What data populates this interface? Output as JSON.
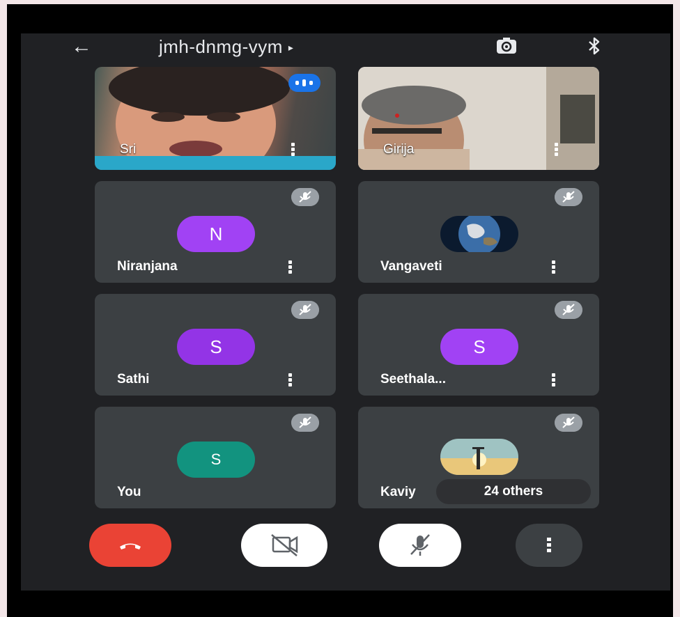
{
  "meeting": {
    "code": "jmh-dnmg-vym",
    "caret": "▸",
    "back_icon": "←"
  },
  "participants": [
    {
      "name": "Sri",
      "type": "video"
    },
    {
      "name": "Girija",
      "type": "video"
    },
    {
      "name": "Niranjana",
      "initial": "N",
      "avatar_color": "#a142f4"
    },
    {
      "name": "Vangaveti",
      "avatar": "earth-photo"
    },
    {
      "name": "Sathi",
      "initial": "S",
      "avatar_color": "#9334e6"
    },
    {
      "name": "Seethala...",
      "initial": "S",
      "avatar_color": "#a142f4"
    },
    {
      "name": "You",
      "initial": "S",
      "avatar_color": "#12937f"
    },
    {
      "name": "Kaviy",
      "avatar": "sky-photo"
    }
  ],
  "others_chip": "24 others",
  "controls": {
    "end_call_color": "#ea4335"
  }
}
